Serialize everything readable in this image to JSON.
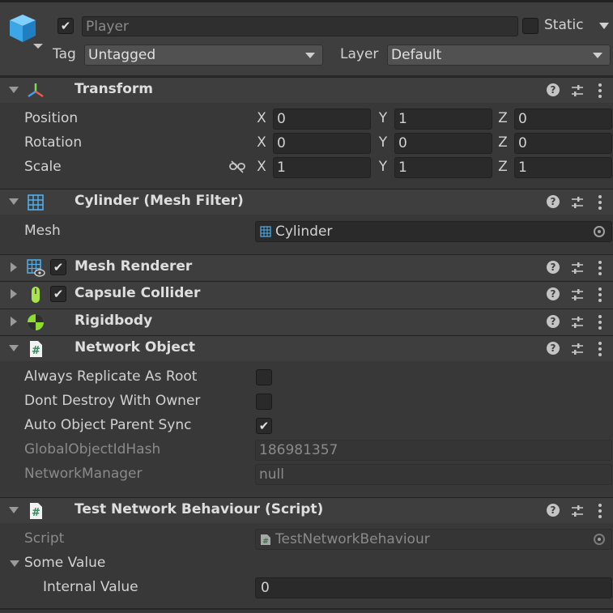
{
  "gameobject": {
    "active": true,
    "name": "Player",
    "static_label": "Static",
    "static_checked": false,
    "tag_label": "Tag",
    "tag_value": "Untagged",
    "layer_label": "Layer",
    "layer_value": "Default",
    "icon": "cube-icon"
  },
  "transform": {
    "title": "Transform",
    "icon": "transform-axes-icon",
    "rows": [
      {
        "label": "Position",
        "x": "0",
        "y": "1",
        "z": "0"
      },
      {
        "label": "Rotation",
        "x": "0",
        "y": "0",
        "z": "0"
      },
      {
        "label": "Scale",
        "x": "1",
        "y": "1",
        "z": "1"
      }
    ],
    "axes": {
      "x": "X",
      "y": "Y",
      "z": "Z"
    },
    "scale_link_icon": "unlinked-chain-icon"
  },
  "mesh_filter": {
    "title": "Cylinder (Mesh Filter)",
    "icon": "mesh-grid-icon",
    "mesh_label": "Mesh",
    "mesh_value": "Cylinder"
  },
  "mesh_renderer": {
    "title": "Mesh Renderer",
    "enabled": true,
    "icon": "mesh-renderer-icon"
  },
  "capsule_collider": {
    "title": "Capsule Collider",
    "enabled": true,
    "icon": "capsule-icon"
  },
  "rigidbody": {
    "title": "Rigidbody",
    "icon": "rigidbody-icon"
  },
  "network_object": {
    "title": "Network Object",
    "icon": "script-hash-icon",
    "always_replicate_label": "Always Replicate As Root",
    "always_replicate": false,
    "dont_destroy_label": "Dont Destroy With Owner",
    "dont_destroy": false,
    "auto_parent_label": "Auto Object Parent Sync",
    "auto_parent": true,
    "hash_label": "GlobalObjectIdHash",
    "hash_value": "186981357",
    "manager_label": "NetworkManager",
    "manager_value": "null"
  },
  "test_behaviour": {
    "title": "Test Network Behaviour (Script)",
    "icon": "script-hash-icon",
    "script_label": "Script",
    "script_value": "TestNetworkBehaviour",
    "some_value_label": "Some Value",
    "internal_label": "Internal Value",
    "internal_value": "0"
  },
  "colors": {
    "background": "#383838",
    "header": "#3e3e3e",
    "field": "#2a2a2a",
    "cube_blue": "#3ba6e8",
    "script_green": "#5fc48a",
    "rigidbody_green": "#8ddc2f",
    "capsule_green": "#a9e54a"
  }
}
